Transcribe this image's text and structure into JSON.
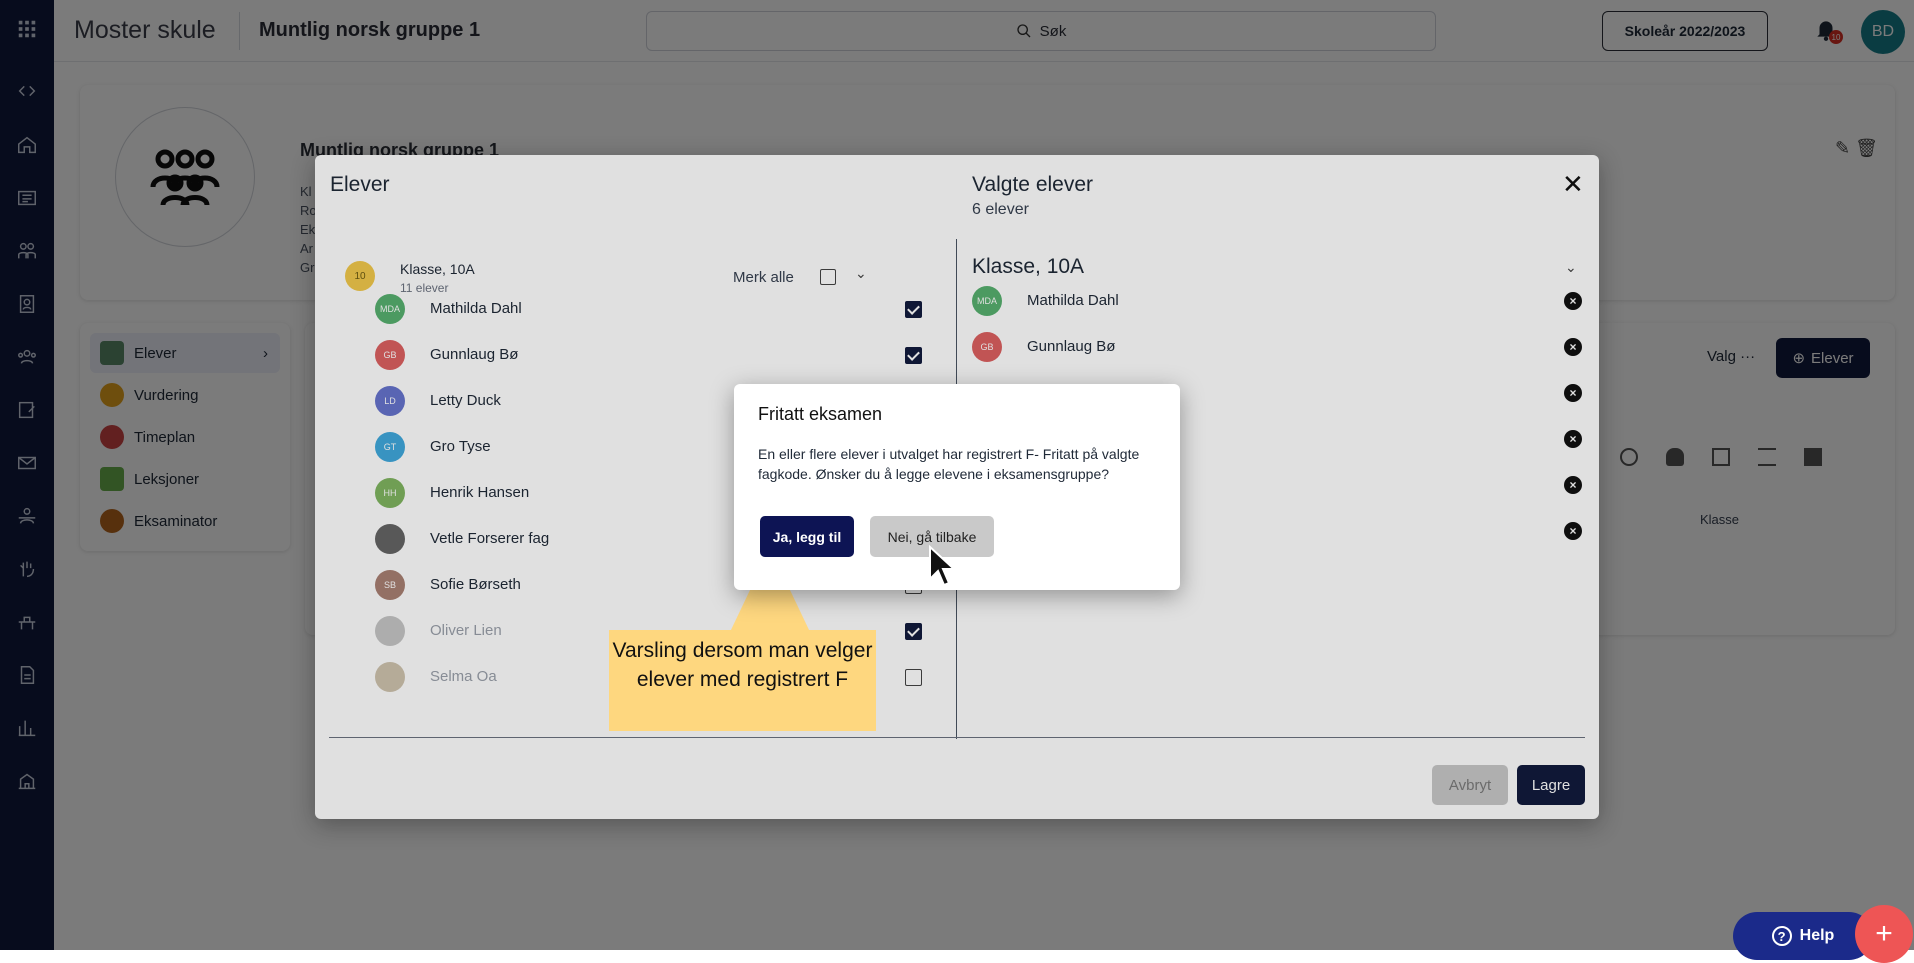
{
  "app": {
    "school": "Moster skule",
    "group_title": "Muntlig norsk gruppe 1",
    "search_label": "Søk",
    "year_button": "Skoleår 2022/2023",
    "notification_count": "10",
    "user_initials": "BD"
  },
  "background": {
    "heading": "Muntlig norsk gruppe 1",
    "meta_lines": [
      "Kl",
      "Ro",
      "Ek",
      "Ar",
      "Gr"
    ],
    "menu": [
      {
        "label": "Elever",
        "icon": "students-icon"
      },
      {
        "label": "Vurdering",
        "icon": "medal-icon"
      },
      {
        "label": "Timeplan",
        "icon": "clock-icon"
      },
      {
        "label": "Leksjoner",
        "icon": "building-icon"
      },
      {
        "label": "Eksaminator",
        "icon": "examiner-icon"
      }
    ],
    "valg_label": "Valg",
    "elever_button": "Elever",
    "klasse_column": "Klasse"
  },
  "modal": {
    "left_title": "Elever",
    "right_title": "Valgte elever",
    "right_subtitle": "6 elever",
    "class_badge": "10",
    "class_name": "Klasse, 10A",
    "class_count": "11 elever",
    "select_all": "Merk alle",
    "students": [
      {
        "initials": "MDA",
        "name": "Mathilda Dahl",
        "checked": true,
        "color": "#3aa356",
        "dim": false
      },
      {
        "initials": "GB",
        "name": "Gunnlaug Bø",
        "checked": true,
        "color": "#d64545",
        "dim": false
      },
      {
        "initials": "LD",
        "name": "Letty Duck",
        "checked": true,
        "color": "#4c5bc4",
        "dim": false
      },
      {
        "initials": "GT",
        "name": "Gro Tyse",
        "checked": true,
        "color": "#1f9ad6",
        "dim": false
      },
      {
        "initials": "HH",
        "name": "Henrik Hansen",
        "checked": true,
        "color": "#6aa845",
        "dim": false
      },
      {
        "initials": "",
        "name": "Vetle Forserer fag",
        "checked": true,
        "color": "#4a4a4a",
        "dim": false
      },
      {
        "initials": "SB",
        "name": "Sofie Børseth",
        "checked": false,
        "color": "#9a6a5a",
        "dim": false
      },
      {
        "initials": "",
        "name": "Oliver Lien",
        "checked": true,
        "color": "#bbbbbb",
        "dim": true
      },
      {
        "initials": "",
        "name": "Selma Oa",
        "checked": false,
        "color": "#c7b8a0",
        "dim": true
      }
    ],
    "selected_class": "Klasse, 10A",
    "selected": [
      {
        "initials": "MDA",
        "name": "Mathilda Dahl",
        "color": "#3aa356"
      },
      {
        "initials": "GB",
        "name": "Gunnlaug Bø",
        "color": "#d64545"
      },
      {
        "initials": "",
        "name": "",
        "color": "transparent"
      },
      {
        "initials": "",
        "name": "",
        "color": "transparent"
      },
      {
        "initials": "",
        "name": "",
        "color": "transparent"
      },
      {
        "initials": "",
        "name": "",
        "color": "transparent"
      }
    ],
    "cancel_button": "Avbryt",
    "save_button": "Lagre"
  },
  "dialog": {
    "title": "Fritatt eksamen",
    "body": "En eller flere elever i utvalget har registrert F- Fritatt på valgte fagkode. Ønsker du å legge elevene i eksamensgruppe?",
    "confirm_button": "Ja, legg til",
    "back_button": "Nei, gå tilbake"
  },
  "callout": {
    "text": "Varsling dersom man velger elever med registrert F"
  },
  "floating": {
    "help_button": "Help",
    "add_button": "+"
  }
}
